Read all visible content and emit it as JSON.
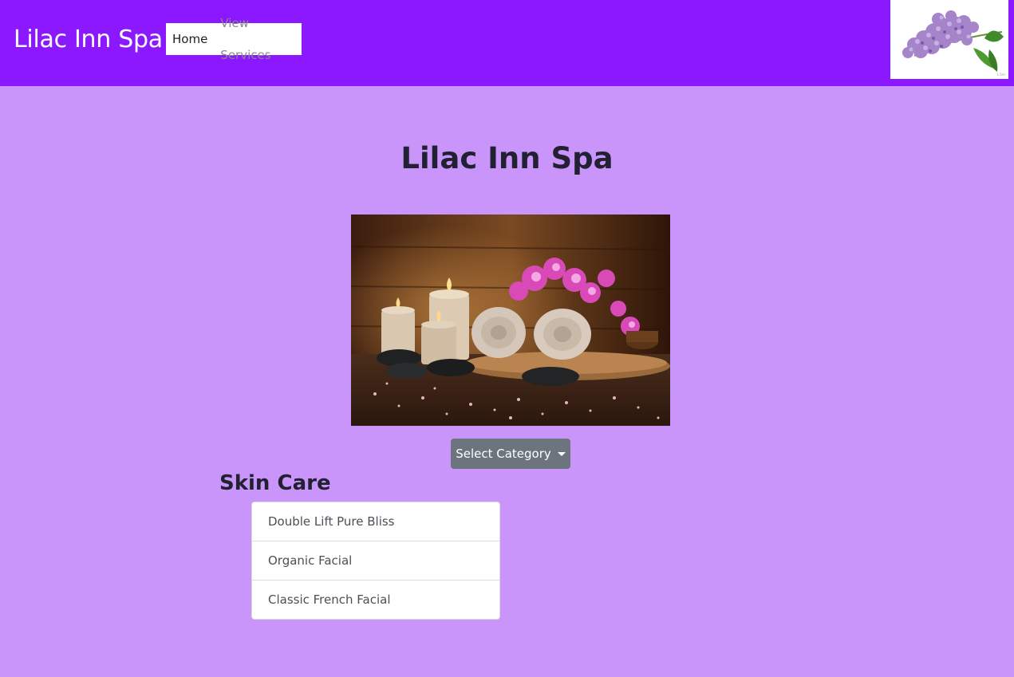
{
  "navbar": {
    "brand": "Lilac Inn Spa",
    "links": [
      {
        "label": "Home",
        "active": true
      },
      {
        "label": "View Services",
        "active": false
      }
    ],
    "logo_icon": "lilac-flower-logo",
    "logo_caption": "Lilac"
  },
  "main": {
    "title": "Lilac Inn Spa",
    "hero_image": "spa-candles-towels-orchids",
    "dropdown_label": "Select Category",
    "section_title": "Skin Care",
    "services": [
      "Double Lift Pure Bliss",
      "Organic Facial",
      "Classic French Facial"
    ]
  },
  "colors": {
    "page_background": "#c995fb",
    "navbar_background": "#8b18ff",
    "button_background": "#6c757d"
  }
}
